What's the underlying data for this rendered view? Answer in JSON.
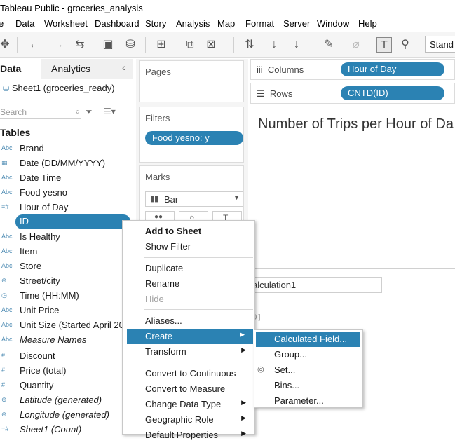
{
  "window": {
    "title": "Tableau Public - groceries_analysis"
  },
  "menubar": [
    "e",
    "Data",
    "Worksheet",
    "Dashboard",
    "Story",
    "Analysis",
    "Map",
    "Format",
    "Server",
    "Window",
    "Help"
  ],
  "toolbar": {
    "standard_label": "Stand"
  },
  "data_pane": {
    "tab_data": "Data",
    "tab_analytics": "Analytics",
    "datasource": "Sheet1 (groceries_ready)",
    "search_placeholder": "Search",
    "tables_label": "Tables",
    "fields": [
      {
        "icon": "Abc",
        "label": "Brand"
      },
      {
        "icon": "cal",
        "label": "Date (DD/MM/YYYY)"
      },
      {
        "icon": "Abc",
        "label": "Date Time"
      },
      {
        "icon": "Abc",
        "label": "Food yesno"
      },
      {
        "icon": "#",
        "label": "Hour of Day"
      },
      {
        "icon": "#",
        "label": "ID"
      },
      {
        "icon": "Abc",
        "label": "Is Healthy"
      },
      {
        "icon": "Abc",
        "label": "Item"
      },
      {
        "icon": "Abc",
        "label": "Store"
      },
      {
        "icon": "geo",
        "label": "Street/city"
      },
      {
        "icon": "time",
        "label": "Time (HH:MM)"
      },
      {
        "icon": "Abc",
        "label": "Unit Price"
      },
      {
        "icon": "Abc",
        "label": "Unit Size (Started April 20"
      },
      {
        "icon": "Abc",
        "label": "Measure Names"
      },
      {
        "icon": "#",
        "label": "Discount"
      },
      {
        "icon": "#",
        "label": "Price (total)"
      },
      {
        "icon": "#",
        "label": "Quantity"
      },
      {
        "icon": "geo",
        "label": "Latitude (generated)"
      },
      {
        "icon": "geo",
        "label": "Longitude (generated)"
      },
      {
        "icon": "#",
        "label": "Sheet1 (Count)"
      }
    ]
  },
  "cards": {
    "pages": "Pages",
    "filters": "Filters",
    "filter_pill": "Food yesno: y",
    "marks": "Marks",
    "mark_type": "Bar"
  },
  "shelves": {
    "columns_label": "Columns",
    "columns_pill": "Hour of Day",
    "rows_label": "Rows",
    "rows_pill": "CNTD(ID)"
  },
  "worksheet": {
    "title": "Number of Trips per Hour of Da",
    "calc_name": "alculation1",
    "bracket_hint": "D]"
  },
  "context_menu": [
    {
      "label": "Add to Sheet",
      "bold": true
    },
    {
      "label": "Show Filter"
    },
    {
      "label": "Duplicate"
    },
    {
      "label": "Rename"
    },
    {
      "label": "Hide",
      "disabled": true
    },
    {
      "label": "Aliases..."
    },
    {
      "label": "Create",
      "submenu": true,
      "highlighted": true
    },
    {
      "label": "Transform",
      "submenu": true
    },
    {
      "label": "Convert to Continuous"
    },
    {
      "label": "Convert to Measure"
    },
    {
      "label": "Change Data Type",
      "submenu": true
    },
    {
      "label": "Geographic Role",
      "submenu": true
    },
    {
      "label": "Default Properties",
      "submenu": true
    }
  ],
  "create_submenu": [
    {
      "label": "Calculated Field...",
      "highlighted": true
    },
    {
      "label": "Group..."
    },
    {
      "label": "Set..."
    },
    {
      "label": "Bins..."
    },
    {
      "label": "Parameter..."
    }
  ],
  "colors": {
    "accent": "#2b82b3"
  }
}
